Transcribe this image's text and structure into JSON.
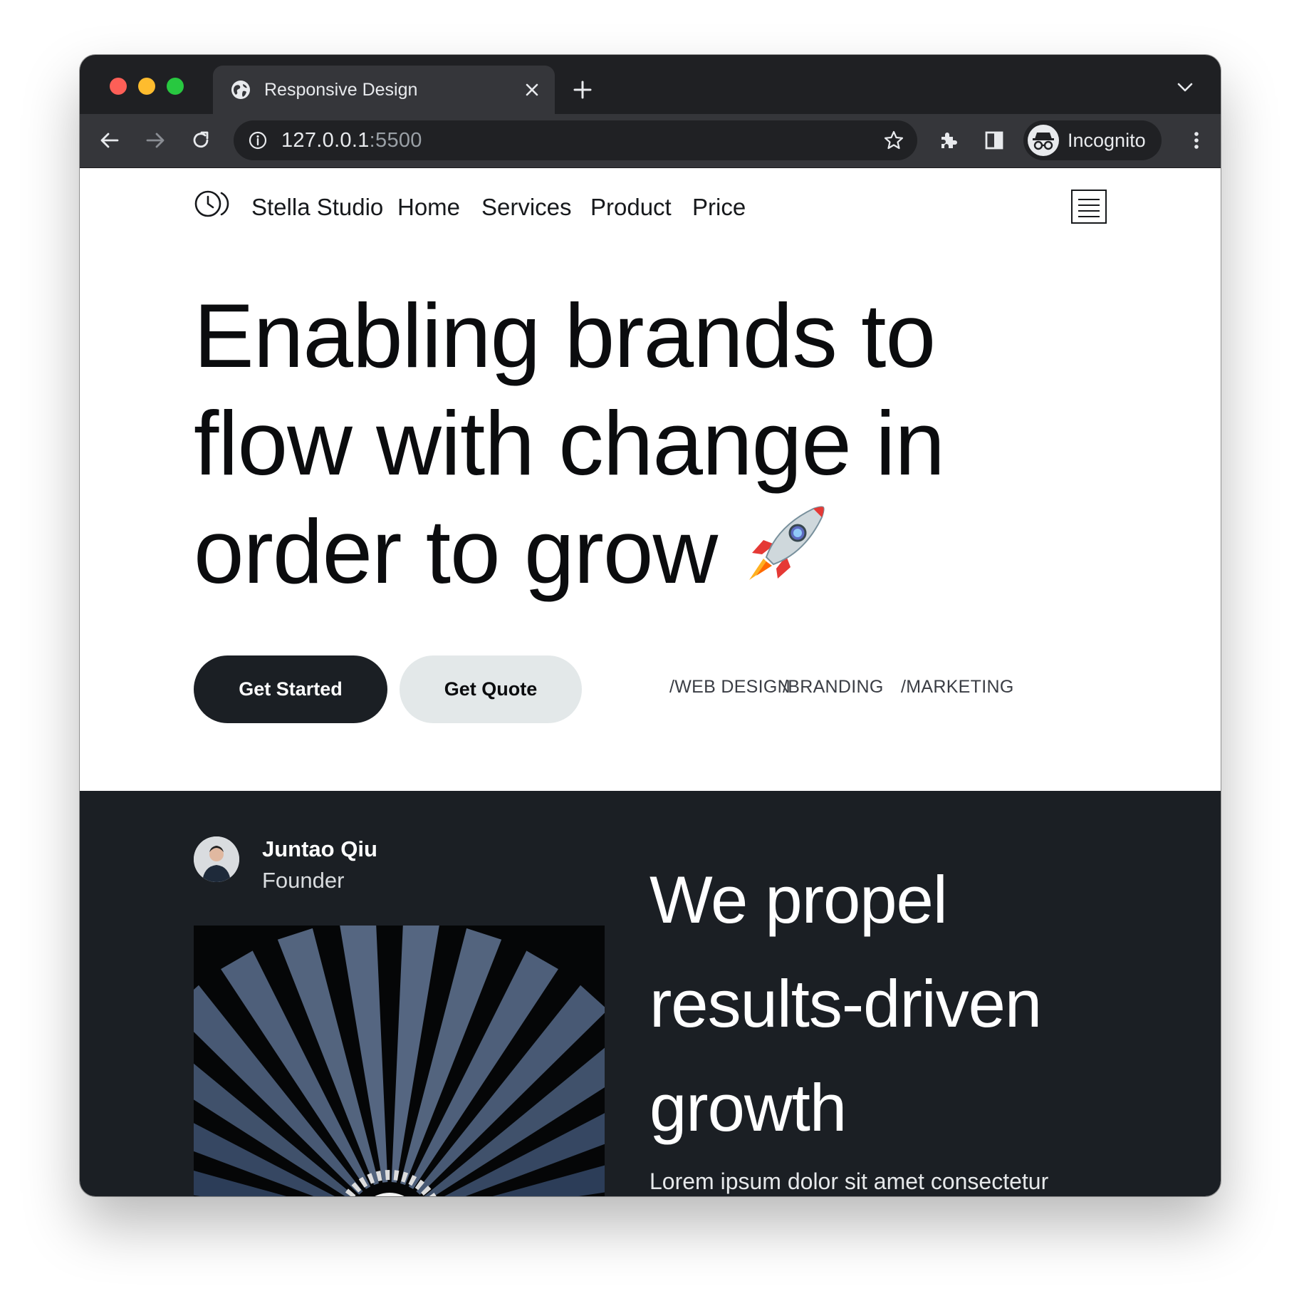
{
  "browser": {
    "tab_title": "Responsive Design",
    "url_host": "127.0.0.1",
    "url_port": ":5500",
    "profile_label": "Incognito",
    "icons": [
      "globe-icon",
      "close-icon",
      "plus-icon",
      "chevron-down-icon",
      "back-arrow-icon",
      "forward-arrow-icon",
      "reload-icon",
      "info-icon",
      "star-icon",
      "puzzle-icon",
      "sidepanel-icon",
      "incognito-icon",
      "kebab-menu-icon"
    ]
  },
  "nav": {
    "brand": "Stella Studio",
    "items": [
      {
        "label": "Home"
      },
      {
        "label": "Services"
      },
      {
        "label": "Product"
      },
      {
        "label": "Price"
      }
    ]
  },
  "hero": {
    "title_line1": "Enabling brands to",
    "title_line2": "flow with change in",
    "title_line3": "order to grow",
    "primary_button": "Get Started",
    "secondary_button": "Get Quote",
    "tags": [
      "/WEB DESIGN",
      "/BRANDING",
      "/MARKETING"
    ]
  },
  "about": {
    "author_name": "Juntao Qiu",
    "author_role": "Founder",
    "title_line1": "We propel",
    "title_line2": "results-driven",
    "title_line3": "growth",
    "body": "Lorem ipsum dolor sit amet consectetur"
  },
  "colors": {
    "dark_background": "#1b1f24",
    "primary_button": "#1b1f24",
    "secondary_button": "#e3e8e9",
    "chrome_tabbar": "#1f2023",
    "chrome_toolbar": "#35363a"
  }
}
